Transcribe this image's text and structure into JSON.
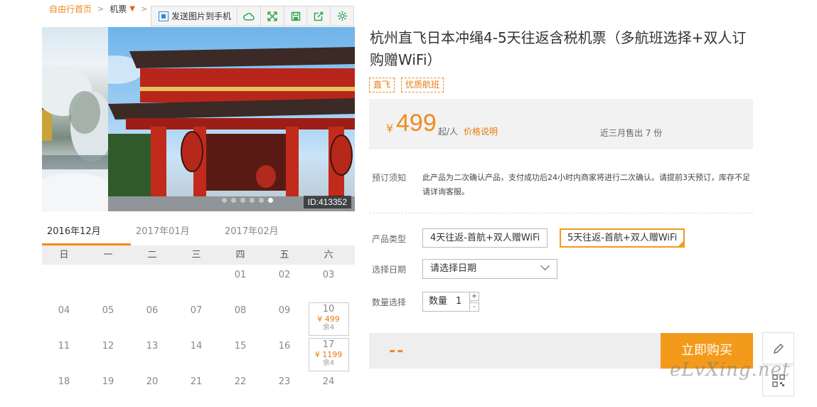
{
  "breadcrumb": {
    "home": "自由行首页",
    "flight": "机票"
  },
  "toolbar": {
    "send_label": "发送图片到手机"
  },
  "gallery": {
    "id_label": "ID:413352",
    "dots": 6,
    "active_dot": 5
  },
  "calendar": {
    "tabs": [
      "2016年12月",
      "2017年01月",
      "2017年02月"
    ],
    "active_tab": 0,
    "weekdays": [
      "日",
      "一",
      "二",
      "三",
      "四",
      "五",
      "六"
    ],
    "rows": [
      [
        {
          "d": ""
        },
        {
          "d": ""
        },
        {
          "d": ""
        },
        {
          "d": ""
        },
        {
          "d": "01"
        },
        {
          "d": "02"
        },
        {
          "d": "03"
        }
      ],
      [
        {
          "d": "04"
        },
        {
          "d": "05"
        },
        {
          "d": "06"
        },
        {
          "d": "07"
        },
        {
          "d": "08"
        },
        {
          "d": "09"
        },
        {
          "d": "10",
          "price": "¥ 499",
          "left": "余4"
        }
      ],
      [
        {
          "d": "11"
        },
        {
          "d": "12"
        },
        {
          "d": "13"
        },
        {
          "d": "14"
        },
        {
          "d": "15"
        },
        {
          "d": "16"
        },
        {
          "d": "17",
          "price": "¥ 1199",
          "left": "余4"
        }
      ],
      [
        {
          "d": "18"
        },
        {
          "d": "19"
        },
        {
          "d": "20"
        },
        {
          "d": "21"
        },
        {
          "d": "22"
        },
        {
          "d": "23"
        },
        {
          "d": "24"
        }
      ]
    ]
  },
  "product": {
    "title": "杭州直飞日本冲绳4-5天往返含税机票（多航班选择+双人订购赠WiFi）",
    "tags": [
      "直飞",
      "优质航班"
    ],
    "currency": "¥",
    "price": "499",
    "unit": "起/人",
    "price_note": "价格说明",
    "sold": "近三月售出 7 份",
    "notice_label": "预订须知",
    "notice_text": "此产品为二次确认产品，支付成功后24小时内商家将进行二次确认。请提前3天预订，库存不足请详询客服。",
    "type_label": "产品类型",
    "types": [
      "4天往返-首航+双人赠WiFi",
      "5天往返-首航+双人赠WiFi"
    ],
    "selected_type": 1,
    "date_label": "选择日期",
    "date_placeholder": "请选择日期",
    "qty_label": "数量选择",
    "qty_prefix": "数量",
    "qty_value": "1",
    "qty_plus": "+",
    "qty_minus": "-",
    "total": "--",
    "buy_label": "立即购买"
  },
  "watermark": "eLvXing.net",
  "colors": {
    "accent": "#f39a1a",
    "price": "#ee8b1f"
  }
}
